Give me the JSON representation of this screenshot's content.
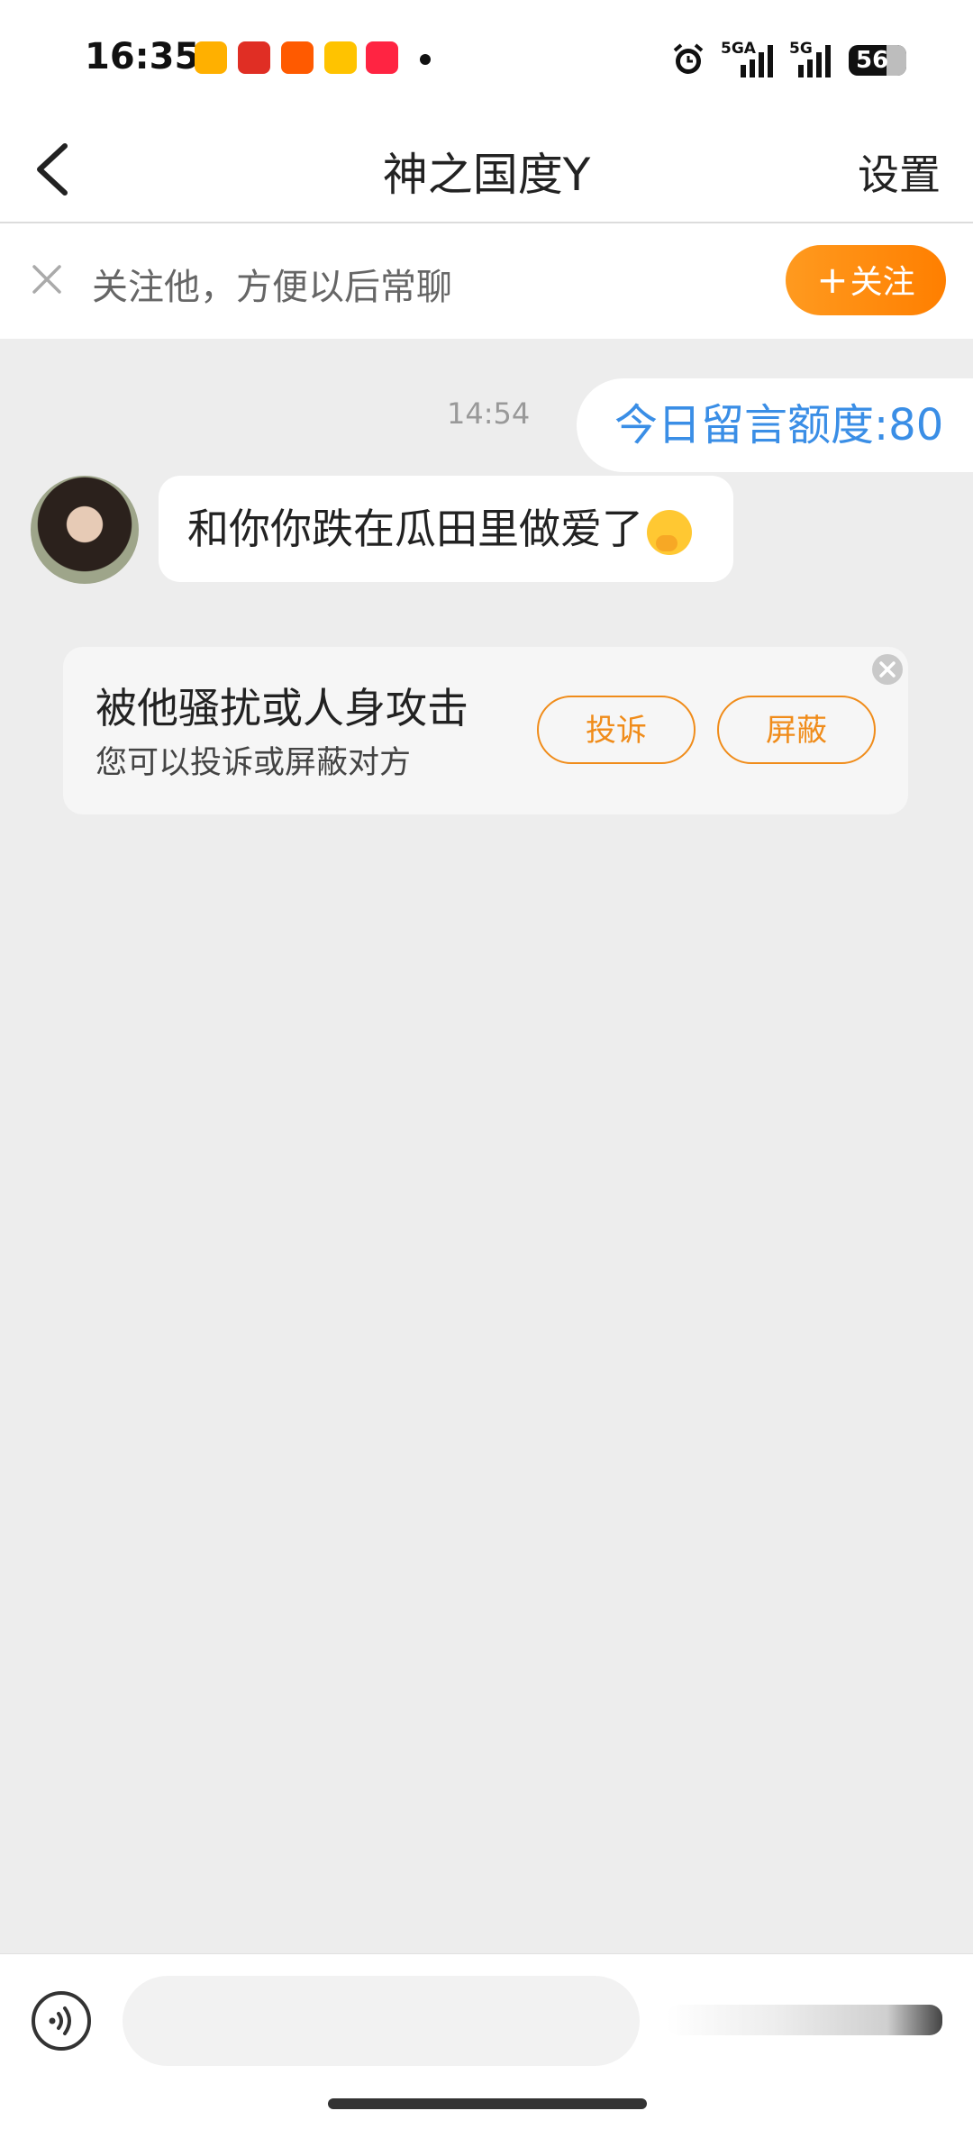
{
  "status_bar": {
    "time": "16:35",
    "net1": "5GA",
    "net2": "5G",
    "battery": "56",
    "apps": [
      "weibo-icon",
      "pinduoduo-icon",
      "alibaba-1688-icon",
      "meituan-icon",
      "xiaohongshu-icon"
    ],
    "app_colors": [
      "#ffb000",
      "#e02e24",
      "#ff5a00",
      "#ffc300",
      "#ff2442"
    ]
  },
  "nav": {
    "title": "神之国度Y",
    "settings": "设置"
  },
  "follow_bar": {
    "tip": "关注他，方便以后常聊",
    "button_plus": "+",
    "button_label": "关注"
  },
  "chat": {
    "timestamp": "14:54",
    "sent_message": "今日留言额度:80",
    "received_message": "和你你跌在瓜田里做爱了"
  },
  "report_card": {
    "title": "被他骚扰或人身攻击",
    "subtitle": "您可以投诉或屏蔽对方",
    "complain": "投诉",
    "block": "屏蔽"
  },
  "colors": {
    "accent": "#ff8c0a",
    "link_blue": "#3a8ee6",
    "background": "#ededed"
  }
}
